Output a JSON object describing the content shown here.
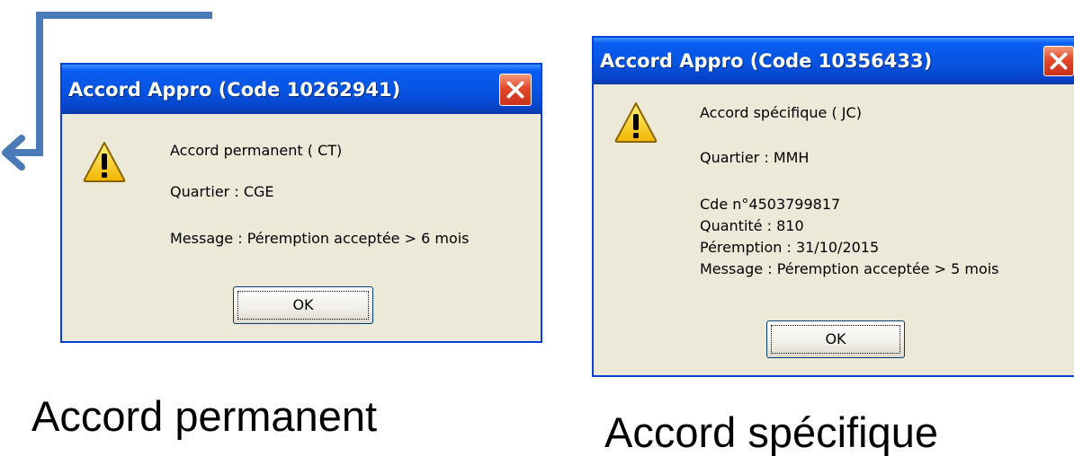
{
  "dialogs": [
    {
      "title": "Accord Appro (Code 10262941)",
      "lines": [
        "Accord permanent ( CT)",
        "Quartier : CGE",
        "Message : Péremption acceptée > 6 mois"
      ],
      "ok_label": "OK",
      "icon": "warning-icon"
    },
    {
      "title": "Accord Appro (Code 10356433)",
      "lines": [
        "Accord spécifique ( JC)",
        "Quartier : MMH",
        "Cde n°4503799817",
        "Quantité : 810",
        "Péremption : 31/10/2015",
        "Message : Péremption acceptée > 5 mois"
      ],
      "ok_label": "OK",
      "icon": "warning-icon"
    }
  ],
  "captions": {
    "left": "Accord permanent",
    "right": "Accord spécifique"
  },
  "colors": {
    "arrow": "#4a7ab8",
    "titlebar": "#0653e1",
    "dialog_bg": "#ece9d8",
    "close_button": "#e4482a"
  }
}
